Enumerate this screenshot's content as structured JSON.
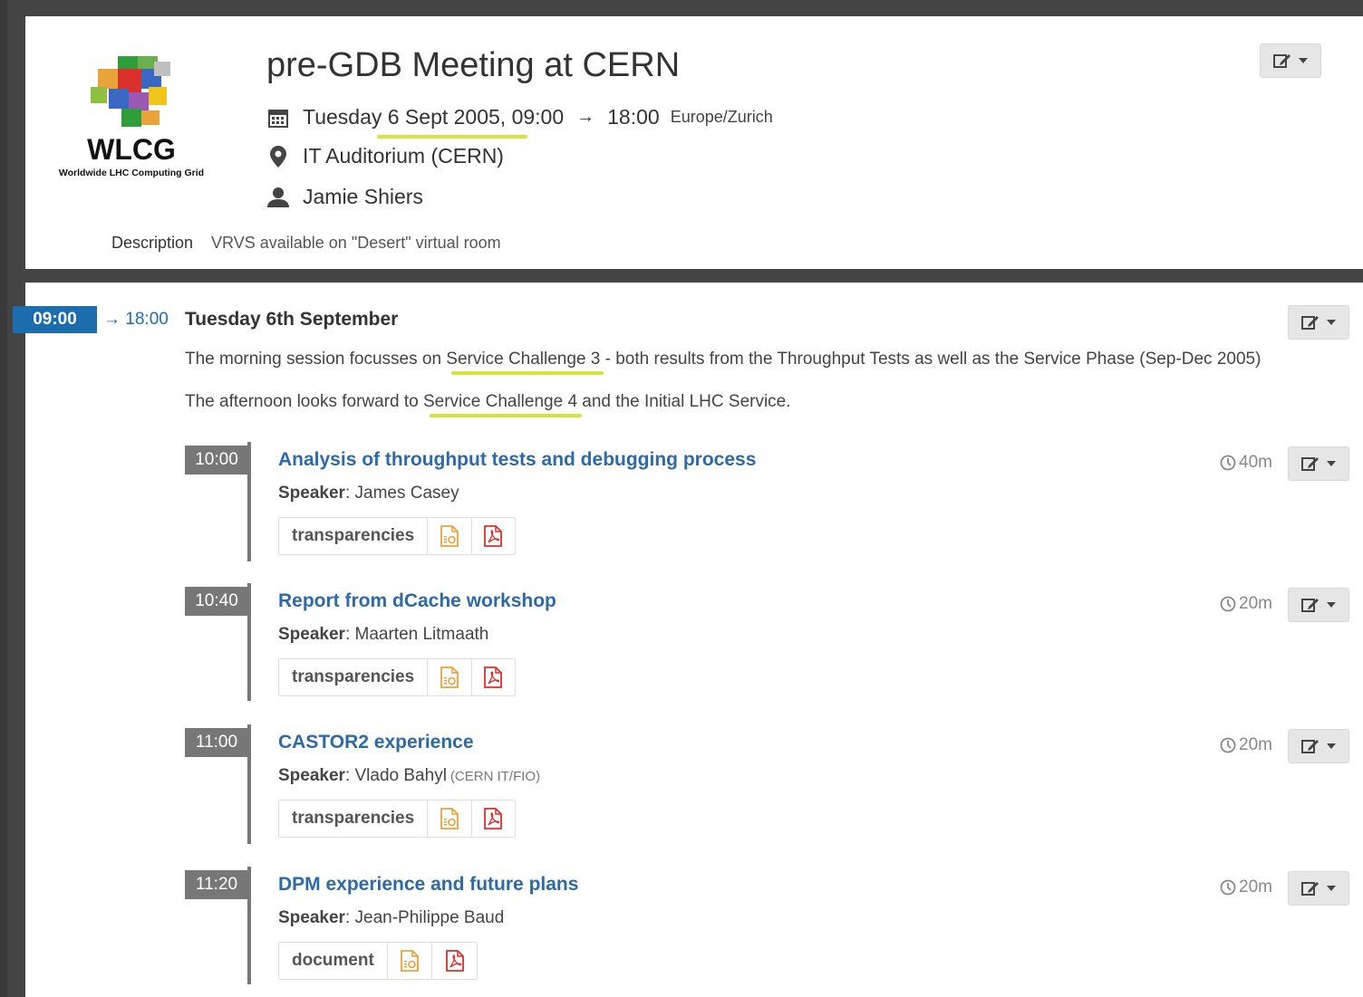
{
  "event": {
    "title": "pre-GDB Meeting at CERN",
    "date_start": "Tuesday 6 Sept 2005, 09:00",
    "arrow": "→",
    "time_end": "18:00",
    "timezone": "Europe/Zurich",
    "location": "IT Auditorium (CERN)",
    "chair": "Jamie Shiers",
    "description_label": "Description",
    "description": "VRVS available on \"Desert\" virtual room",
    "logo": {
      "name": "WLCG",
      "subtitle": "Worldwide LHC Computing Grid"
    }
  },
  "session": {
    "start": "09:00",
    "end": "→ 18:00",
    "title": "Tuesday 6th September",
    "desc1": "The morning session focusses on Service Challenge 3 - both results from the Throughput Tests as well as the Service Phase (Sep-Dec 2005)",
    "desc2": "The afternoon looks forward to Service Challenge 4 and the Initial LHC Service."
  },
  "contributions": [
    {
      "time": "10:00",
      "title": "Analysis of throughput tests and debugging process",
      "speaker_label": "Speaker",
      "speaker": ": James Casey",
      "affiliation": "",
      "material": "transparencies",
      "duration": "40m"
    },
    {
      "time": "10:40",
      "title": "Report from dCache workshop",
      "speaker_label": "Speaker",
      "speaker": ": Maarten Litmaath",
      "affiliation": "",
      "material": "transparencies",
      "duration": "20m"
    },
    {
      "time": "11:00",
      "title": "CASTOR2 experience",
      "speaker_label": "Speaker",
      "speaker": ": Vlado Bahyl",
      "affiliation": "(CERN IT/FIO)",
      "material": "transparencies",
      "duration": "20m"
    },
    {
      "time": "11:20",
      "title": "DPM experience and future plans",
      "speaker_label": "Speaker",
      "speaker": ": Jean-Philippe Baud",
      "affiliation": "",
      "material": "document",
      "duration": "20m"
    }
  ],
  "colors": {
    "accent": "#1c6dad",
    "link": "#2c6aa8",
    "highlight": "#d6e33a",
    "ppt": "#e8a23c",
    "pdf": "#d9302c"
  },
  "icons": [
    "calendar-icon",
    "map-pin-icon",
    "user-icon",
    "edit-icon",
    "clock-icon",
    "ppt-file-icon",
    "pdf-file-icon"
  ]
}
